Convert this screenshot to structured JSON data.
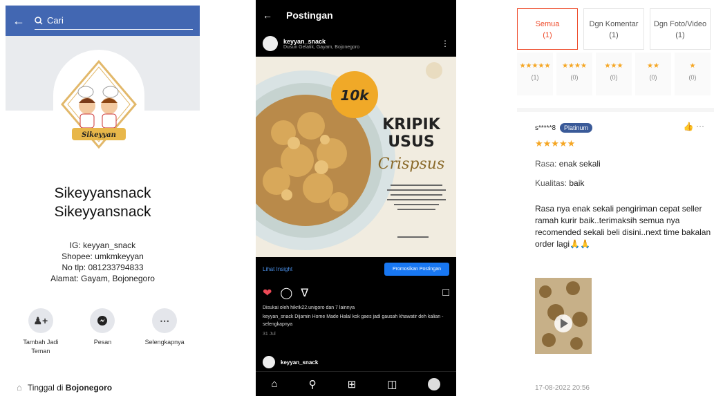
{
  "facebook": {
    "search_placeholder": "Cari",
    "logo_text": "Sikeyyan",
    "name_line1": "Sikeyyansnack",
    "name_line2": "Sikeyyansnack",
    "info": [
      "IG: keyyan_snack",
      "Shopee: umkmkeyyan",
      "No tlp: 081233794833",
      "Alamat: Gayam, Bojonegoro"
    ],
    "actions": [
      {
        "label": "Tambah Jadi Teman",
        "icon": "add-friend-icon"
      },
      {
        "label": "Pesan",
        "icon": "messenger-icon"
      },
      {
        "label": "Selengkapnya",
        "icon": "more-icon"
      }
    ],
    "lives_in_prefix": "Tinggal di ",
    "lives_in_place": "Bojonegoro"
  },
  "instagram": {
    "title": "Postingan",
    "account": "keyyan_snack",
    "account_sub": "Dusun Gelatik, Gayam, Bojonegoro",
    "post": {
      "price": "10k",
      "headline1": "KRIPIK",
      "headline2": "USUS",
      "script": "Crispsus"
    },
    "insight_link": "Lihat Insight",
    "promote_button": "Promosikan Postingan",
    "liked_by": "Disukai oleh hikrik22.unigoro dan 7 lainnya",
    "caption": "keyyan_snack Dijamin Home Made Halal kok gaes jadi gausah khawatir deh kalian - selengkapnya",
    "time": "31 Jul",
    "comment_account": "keyyan_snack",
    "accent": "#1877f2"
  },
  "reviews": {
    "filters": [
      {
        "label": "Semua",
        "count": "(1)"
      },
      {
        "label": "Dgn Komentar",
        "count": "(1)"
      },
      {
        "label": "Dgn Foto/Video",
        "count": "(1)"
      }
    ],
    "star_filters": [
      {
        "stars": "★★★★★",
        "count": "(1)"
      },
      {
        "stars": "★★★★",
        "count": "(0)"
      },
      {
        "stars": "★★★",
        "count": "(0)"
      },
      {
        "stars": "★★",
        "count": "(0)"
      },
      {
        "stars": "★",
        "count": "(0)"
      }
    ],
    "user": "s*****8",
    "badge": "Platinum",
    "rating": "★★★★★",
    "rasa_label": "Rasa:",
    "rasa_value": "enak sekali",
    "kualitas_label": "Kualitas:",
    "kualitas_value": "baik",
    "text": "Rasa nya enak sekali pengiriman cepat seller ramah kurir baik..terimaksih semua nya recomended sekali beli disini..next time bakalan order lagi🙏🙏",
    "date": "17-08-2022 20:56",
    "accent": "#ee4d2d"
  }
}
